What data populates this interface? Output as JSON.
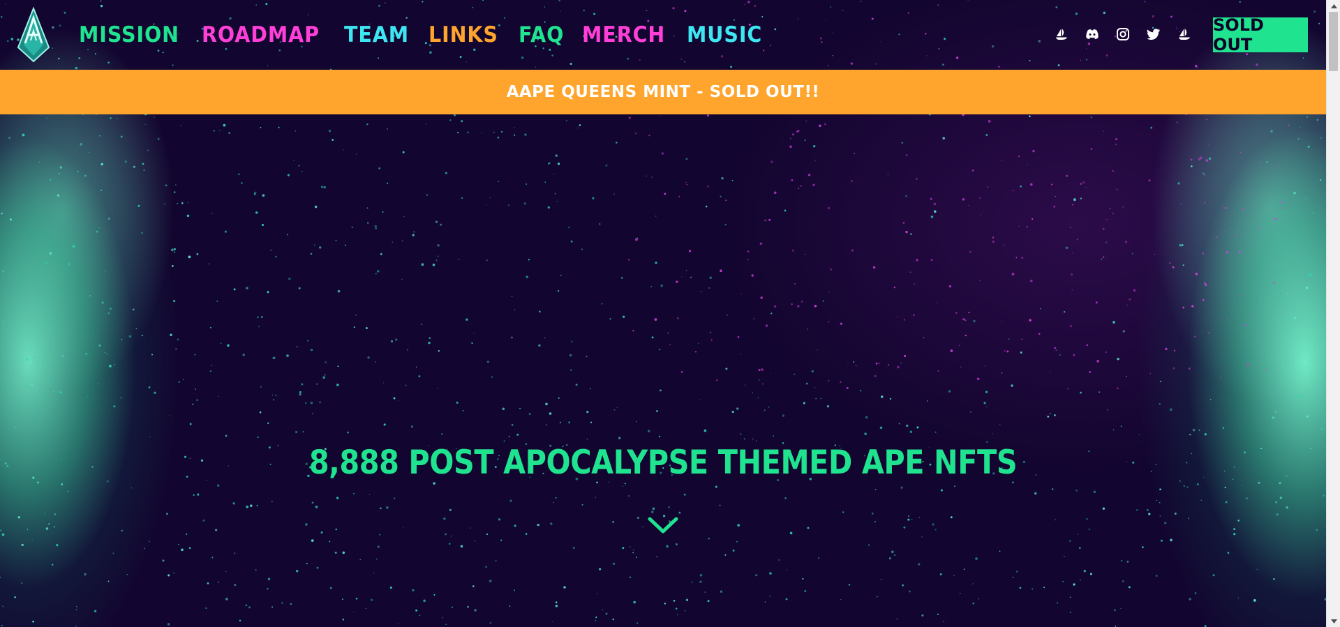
{
  "header": {
    "logo_icon": "aa-crystal-logo",
    "nav": [
      {
        "label": "MISSION",
        "color": "#1fe38f"
      },
      {
        "label": "ROADMAP",
        "color": "#ff3fd8"
      },
      {
        "label": "TEAM",
        "color": "#3ee6f2"
      },
      {
        "label": "LINKS",
        "color": "#ffa42c"
      },
      {
        "label": "FAQ",
        "color": "#1fe38f"
      },
      {
        "label": "MERCH",
        "color": "#ff3fd8"
      },
      {
        "label": "MUSIC",
        "color": "#3ee6f2"
      }
    ],
    "socials": [
      "opensea-icon",
      "discord-icon",
      "instagram-icon",
      "twitter-icon",
      "opensea-icon"
    ],
    "cta_label": "SOLD OUT"
  },
  "banner": {
    "text": "AAPE QUEENS MINT - SOLD OUT!!"
  },
  "hero": {
    "title": "8,888 POST APOCALYPSE THEMED APE NFTS",
    "scroll_icon": "chevron-down-icon"
  },
  "colors": {
    "background": "#12052f",
    "accent_green": "#1fe38f",
    "accent_pink": "#ff3fd8",
    "accent_cyan": "#3ee6f2",
    "accent_orange": "#ffa42c"
  }
}
